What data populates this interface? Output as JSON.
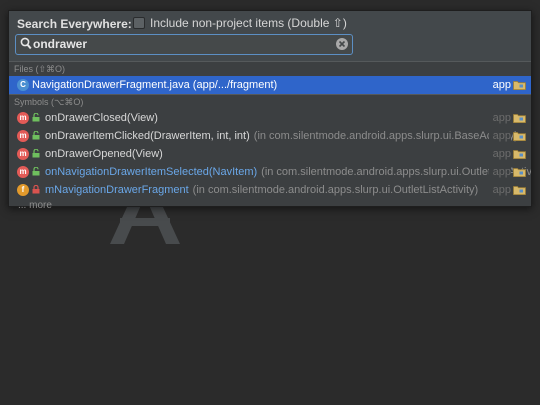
{
  "search": {
    "title": "Search Everywhere:",
    "include_label": "Include non-project items (Double ⇧)",
    "include_checked": false,
    "query": "ondrawer"
  },
  "files_section": {
    "header": "Files (⇧⌘O)",
    "items": [
      {
        "icon": "C",
        "name": "NavigationDrawerFragment.java (app/.../fragment)",
        "module": "app"
      }
    ]
  },
  "symbols_section": {
    "header": "Symbols (⌥⌘O)",
    "items": [
      {
        "icon": "m",
        "name": "onDrawerClosed(View)",
        "detail": "",
        "module": "app"
      },
      {
        "icon": "m",
        "name": "onDrawerItemClicked(DrawerItem, int, int)",
        "detail": "(in com.silentmode.android.apps.slurp.ui.BaseActivity)",
        "module": "app"
      },
      {
        "icon": "m",
        "name": "onDrawerOpened(View)",
        "detail": "",
        "module": "app"
      },
      {
        "icon": "m",
        "name": "onNavigationDrawerItemSelected(NavItem)",
        "detail": "(in com.silentmode.android.apps.slurp.ui.OutletListActivity)",
        "module": "app"
      },
      {
        "icon": "f",
        "name": "mNavigationDrawerFragment",
        "detail": "(in com.silentmode.android.apps.slurp.ui.OutletListActivity)",
        "module": "app"
      }
    ]
  },
  "more_label": "... more",
  "colors": {
    "background": "#2b2b2b",
    "popup": "#3c3f41",
    "selection": "#2f65ca",
    "method_icon": "#e35b57",
    "field_icon": "#e29a2c",
    "class_icon": "#4a8fd1",
    "link_text": "#6aa7e8"
  }
}
